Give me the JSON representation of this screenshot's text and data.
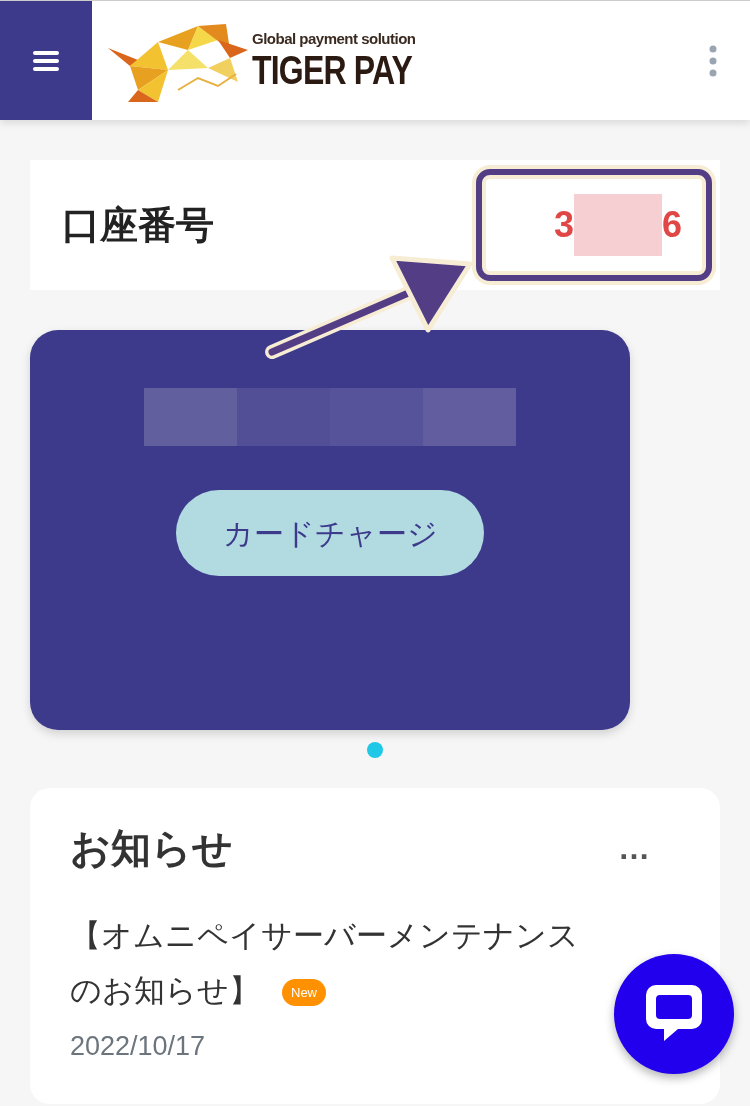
{
  "header": {
    "logo": {
      "tagline": "Global payment solution",
      "name": "TIGER PAY"
    }
  },
  "account": {
    "label": "口座番号",
    "number_start": "3",
    "number_end": "6",
    "redacted": true,
    "highlighted": true
  },
  "card": {
    "balance_redacted": true,
    "button": "カードチャージ"
  },
  "carousel_dots": [
    {
      "selected": true
    }
  ],
  "notices": {
    "title": "お知らせ",
    "more": "…",
    "items": [
      {
        "title_lines": [
          "【オムニペイサーバーメンテナンス",
          "のお知らせ】"
        ],
        "is_new": true,
        "badge": "New",
        "date": "2022/10/17"
      }
    ]
  }
}
